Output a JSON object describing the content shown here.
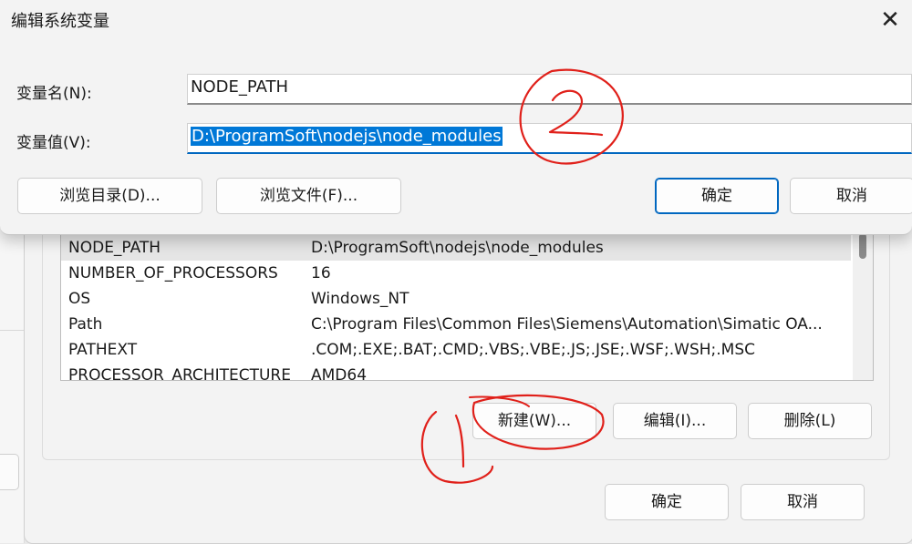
{
  "dialog": {
    "title": "编辑系统变量",
    "name_label": "变量名(N):",
    "name_value": "NODE_PATH",
    "value_label": "变量值(V):",
    "value_value": "D:\\ProgramSoft\\nodejs\\node_modules",
    "browse_dir_button": "浏览目录(D)...",
    "browse_file_button": "浏览文件(F)...",
    "ok_button": "确定",
    "cancel_button": "取消"
  },
  "parent": {
    "variables": [
      {
        "name": "NODE_PATH",
        "value": "D:\\ProgramSoft\\nodejs\\node_modules"
      },
      {
        "name": "NUMBER_OF_PROCESSORS",
        "value": "16"
      },
      {
        "name": "OS",
        "value": "Windows_NT"
      },
      {
        "name": "Path",
        "value": "C:\\Program Files\\Common Files\\Siemens\\Automation\\Simatic OA..."
      },
      {
        "name": "PATHEXT",
        "value": ".COM;.EXE;.BAT;.CMD;.VBS;.VBE;.JS;.JSE;.WSF;.WSH;.MSC"
      },
      {
        "name": "PROCESSOR_ARCHITECTURE",
        "value": "AMD64"
      }
    ],
    "new_button": "新建(W)...",
    "edit_button": "编辑(I)...",
    "delete_button": "删除(L)",
    "ok_button": "确定",
    "cancel_button": "取消"
  },
  "annotations": {
    "color": "#e0201a"
  }
}
